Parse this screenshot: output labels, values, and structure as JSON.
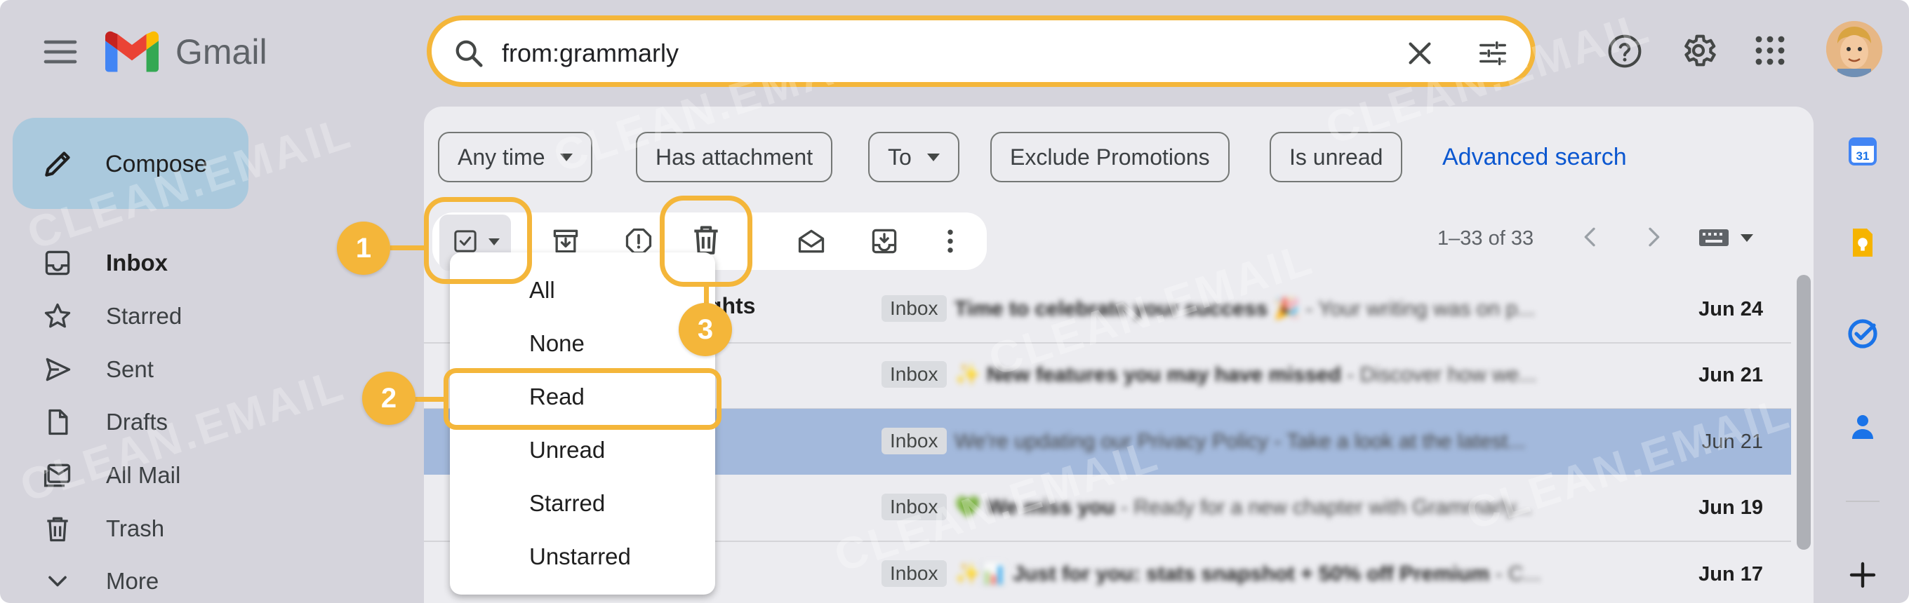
{
  "brand": {
    "name": "Gmail"
  },
  "search": {
    "query": "from:grammarly"
  },
  "sidebar": {
    "compose_label": "Compose",
    "items": [
      {
        "label": "Inbox",
        "icon": "inbox-icon",
        "active": true
      },
      {
        "label": "Starred",
        "icon": "star-icon"
      },
      {
        "label": "Sent",
        "icon": "send-icon"
      },
      {
        "label": "Drafts",
        "icon": "draft-icon"
      },
      {
        "label": "All Mail",
        "icon": "all-mail-icon"
      },
      {
        "label": "Trash",
        "icon": "trash-icon"
      },
      {
        "label": "More",
        "icon": "chevron-down-icon"
      }
    ]
  },
  "filters": {
    "any_time": "Any time",
    "has_attachment": "Has attachment",
    "to": "To",
    "exclude_promotions": "Exclude Promotions",
    "is_unread": "Is unread",
    "advanced_search": "Advanced search"
  },
  "pager": {
    "text": "1–33 of 33"
  },
  "select_menu": {
    "items": [
      "All",
      "None",
      "Read",
      "Unread",
      "Starred",
      "Unstarred"
    ]
  },
  "emails": [
    {
      "sender_fragment": "ights",
      "badge": "Inbox",
      "subject": "Time to celebrate your success 🎉",
      "snippet": " - Your writing was on p...",
      "date": "Jun 24"
    },
    {
      "badge": "Inbox",
      "subject": "✨ New features you may have missed",
      "snippet": " - Discover how we...",
      "date": "Jun 21"
    },
    {
      "badge": "Inbox",
      "subject": "We're updating our Privacy Policy",
      "snippet": " - Take a look at the latest...",
      "date": "Jun 21",
      "selected": true
    },
    {
      "badge": "Inbox",
      "subject": "💚 We miss you",
      "snippet": " - Ready for a new chapter with Grammarly...",
      "date": "Jun 19"
    },
    {
      "badge": "Inbox",
      "subject": "✨📊 Just for you: stats snapshot + 50% off Premium",
      "snippet": " - C...",
      "date": "Jun 17"
    }
  ],
  "steps": {
    "one": "1",
    "two": "2",
    "three": "3"
  },
  "watermark": "CLEAN.EMAIL",
  "colors": {
    "highlight": "#f4b63a",
    "link": "#0b57d0",
    "selected_row": "#a3b9dc",
    "compose_bg": "#aac9dd"
  }
}
